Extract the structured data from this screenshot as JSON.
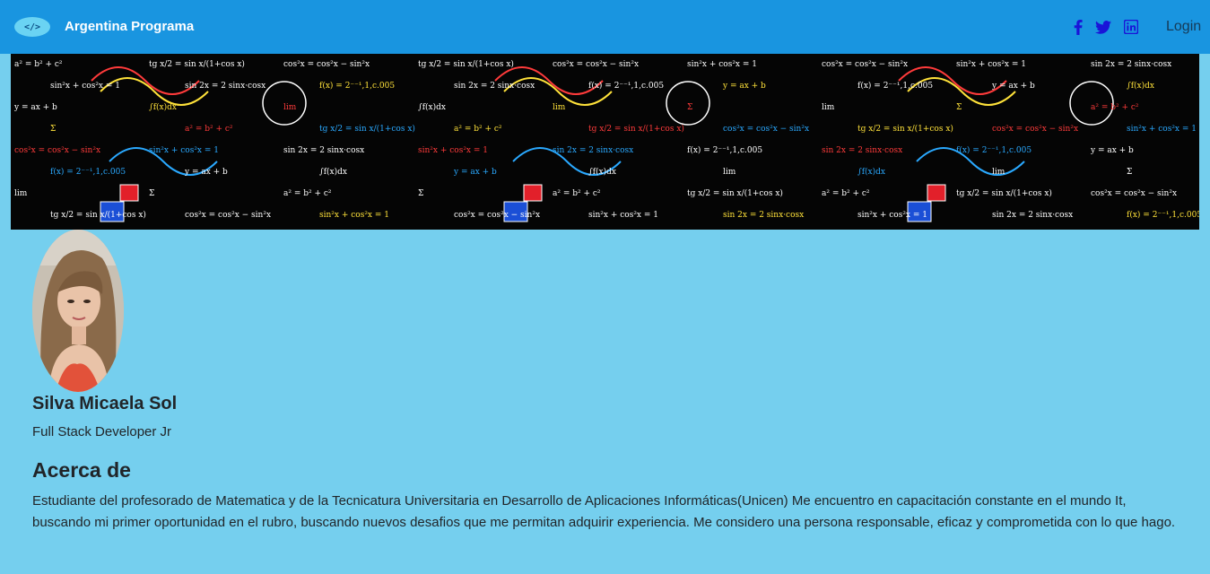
{
  "nav": {
    "logo_text": "</>",
    "brand": "Argentina Programa",
    "social": [
      {
        "icon": "facebook-icon",
        "color": "#1a14d8"
      },
      {
        "icon": "twitter-icon",
        "color": "#1a14d8"
      },
      {
        "icon": "linkedin-icon",
        "color": "#1a14d8"
      }
    ],
    "login_label": "Login"
  },
  "banner": {
    "image": "math-formulas-banner",
    "formula_snippets": [
      "a² = b² + c²",
      "tg x/2 = sin x/(1+cos x)",
      "cos²x = cos²x − sin²x",
      "sin²x + cos²x = 1",
      "sin 2x = 2 sinx·cosx",
      "f(x) = 2⁻⁻¹,1,c.005",
      "y = ax + b",
      "∫f(x)dx",
      "lim",
      "Σ"
    ]
  },
  "profile": {
    "name": "Silva Micaela Sol",
    "role": "Full Stack Developer Jr",
    "avatar": "profile-photo"
  },
  "about": {
    "title": "Acerca de",
    "text": "Estudiante del profesorado de Matematica y de la Tecnicatura Universitaria en Desarrollo de Aplicaciones Informáticas(Unicen) Me encuentro en capacitación constante en el mundo It, buscando mi primer oportunidad en el rubro, buscando nuevos desafios que me permitan adquirir experiencia. Me considero una persona responsable, eficaz y comprometida con lo que hago."
  }
}
